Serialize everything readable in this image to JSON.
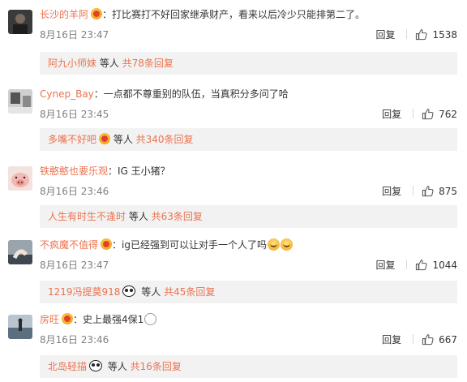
{
  "comments": [
    {
      "username": "长沙的羊阿",
      "has_badge": true,
      "text": "打比赛打不好回家继承财产，看来以后冷少只能排第二了。",
      "emojis": [],
      "time": "8月16日 23:47",
      "reply_label": "回复",
      "likes": "1538",
      "sub": {
        "name": "阿九小师妹",
        "mid": " 等人 ",
        "count": "共78条回复",
        "panda": false
      },
      "avatar": "dark-portrait"
    },
    {
      "username": "Cynep_Bay",
      "has_badge": false,
      "text": "一点都不尊重别的队伍，当真积分多问了哈",
      "emojis": [],
      "time": "8月16日 23:45",
      "reply_label": "回复",
      "likes": "762",
      "sub": {
        "name": "多嘴不好吧",
        "mid": " 等人 ",
        "count": "共340条回复",
        "panda": false,
        "badge": true
      },
      "avatar": "desk-scene"
    },
    {
      "username": "铁憨憨也要乐观",
      "has_badge": false,
      "text": "IG 王小猪？",
      "emojis": [],
      "time": "8月16日 23:46",
      "reply_label": "回复",
      "likes": "875",
      "sub": {
        "name": "人生有时生不逢时",
        "mid": " 等人 ",
        "count": "共63条回复",
        "panda": false
      },
      "avatar": "pig"
    },
    {
      "username": "不疯魔不值得",
      "has_badge": true,
      "text": "ig已经强到可以让对手一个人了吗",
      "emojis": [
        "smile",
        "smile"
      ],
      "time": "8月16日 23:47",
      "reply_label": "回复",
      "likes": "1044",
      "sub": {
        "name": "1219冯提莫918",
        "mid": " 等人 ",
        "count": "共45条回复",
        "panda": true
      },
      "avatar": "hand"
    },
    {
      "username": "房旺",
      "has_badge": true,
      "text": "史上最强4保1",
      "emojis": [
        "glasses"
      ],
      "time": "8月16日 23:46",
      "reply_label": "回复",
      "likes": "667",
      "sub": {
        "name": "北岛轻描",
        "mid": " 等人 ",
        "count": "共16条回复",
        "panda": true
      },
      "avatar": "seaside"
    }
  ],
  "colors": {
    "link": "#eb7350",
    "time": "#808080",
    "subreply_bg": "#f2f2f2"
  }
}
